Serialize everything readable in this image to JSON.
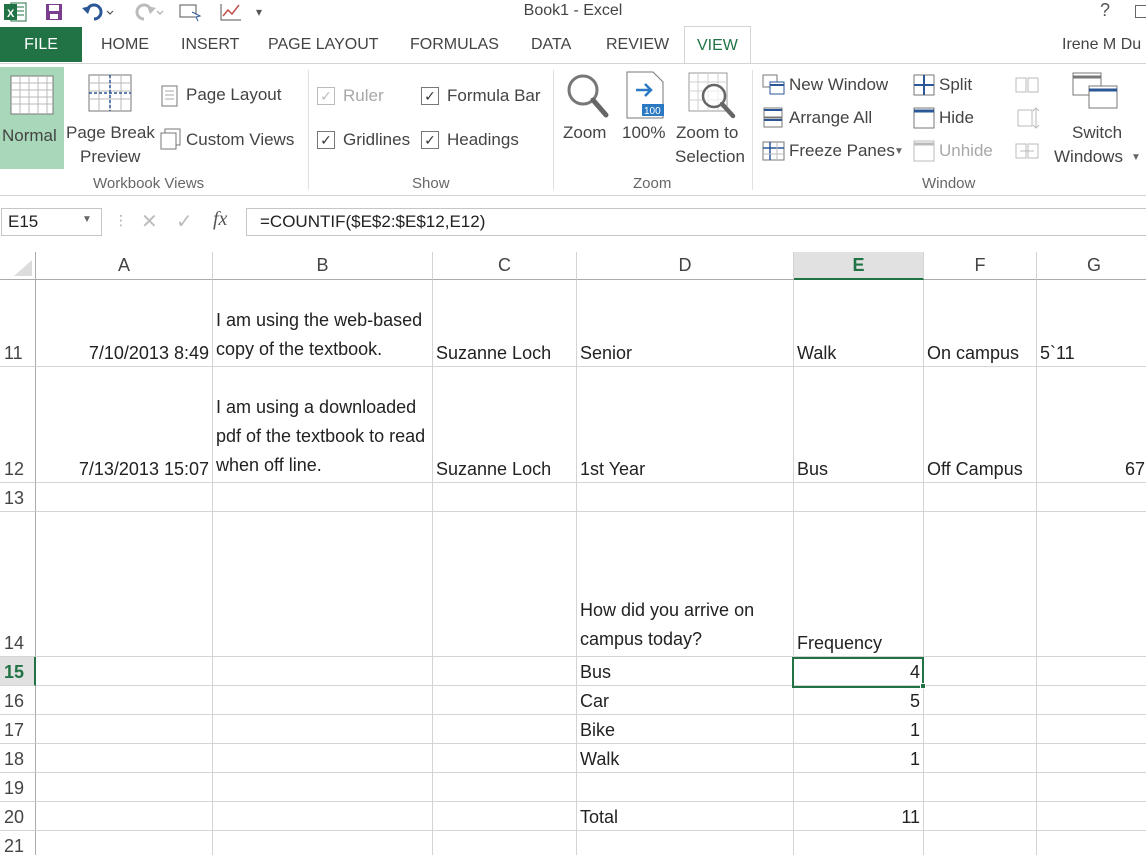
{
  "window": {
    "title": "Book1 - Excel",
    "help": "?"
  },
  "tabs": {
    "file": "FILE",
    "items": [
      "HOME",
      "INSERT",
      "PAGE LAYOUT",
      "FORMULAS",
      "DATA",
      "REVIEW",
      "VIEW"
    ],
    "active": "VIEW",
    "user": "Irene M Du"
  },
  "ribbon": {
    "workbook_views": {
      "label": "Workbook Views",
      "normal": "Normal",
      "page_break_1": "Page Break",
      "page_break_2": "Preview",
      "page_layout": "Page Layout",
      "custom_views": "Custom Views"
    },
    "show": {
      "label": "Show",
      "ruler": "Ruler",
      "formula_bar": "Formula Bar",
      "gridlines": "Gridlines",
      "headings": "Headings"
    },
    "zoom": {
      "label": "Zoom",
      "zoom": "Zoom",
      "hundred": "100%",
      "hundred_badge": "100",
      "zoom_sel_1": "Zoom to",
      "zoom_sel_2": "Selection"
    },
    "window": {
      "label": "Window",
      "new_window": "New Window",
      "arrange_all": "Arrange All",
      "freeze_panes": "Freeze Panes",
      "split": "Split",
      "hide": "Hide",
      "unhide": "Unhide",
      "switch_1": "Switch",
      "switch_2": "Windows"
    }
  },
  "formula_bar": {
    "name_box": "E15",
    "formula": "=COUNTIF($E$2:$E$12,E12)",
    "fx": "fx"
  },
  "grid": {
    "columns": [
      "A",
      "B",
      "C",
      "D",
      "E",
      "F",
      "G"
    ],
    "selected_column": "E",
    "selected_row": "15",
    "rows": [
      {
        "n": "11",
        "A": "7/10/2013 8:49",
        "B": "I am using the web-based copy of the textbook.",
        "C": "Suzanne Loch",
        "D": "Senior",
        "E": "Walk",
        "F": "On campus",
        "G": "5`11"
      },
      {
        "n": "12",
        "A": "7/13/2013 15:07",
        "B": "I am using a downloaded pdf of the textbook to read when off line.",
        "C": "Suzanne Loch",
        "D": "1st Year",
        "E": "Bus",
        "F": "Off Campus",
        "G": "67"
      },
      {
        "n": "13"
      },
      {
        "n": "14",
        "D": "How did you arrive on campus today?",
        "E": "Frequency"
      },
      {
        "n": "15",
        "D": "Bus",
        "E": "4"
      },
      {
        "n": "16",
        "D": "Car",
        "E": "5"
      },
      {
        "n": "17",
        "D": "Bike",
        "E": "1"
      },
      {
        "n": "18",
        "D": "Walk",
        "E": "1"
      },
      {
        "n": "19"
      },
      {
        "n": "20",
        "D": "Total",
        "E": "11"
      },
      {
        "n": "21"
      }
    ]
  }
}
